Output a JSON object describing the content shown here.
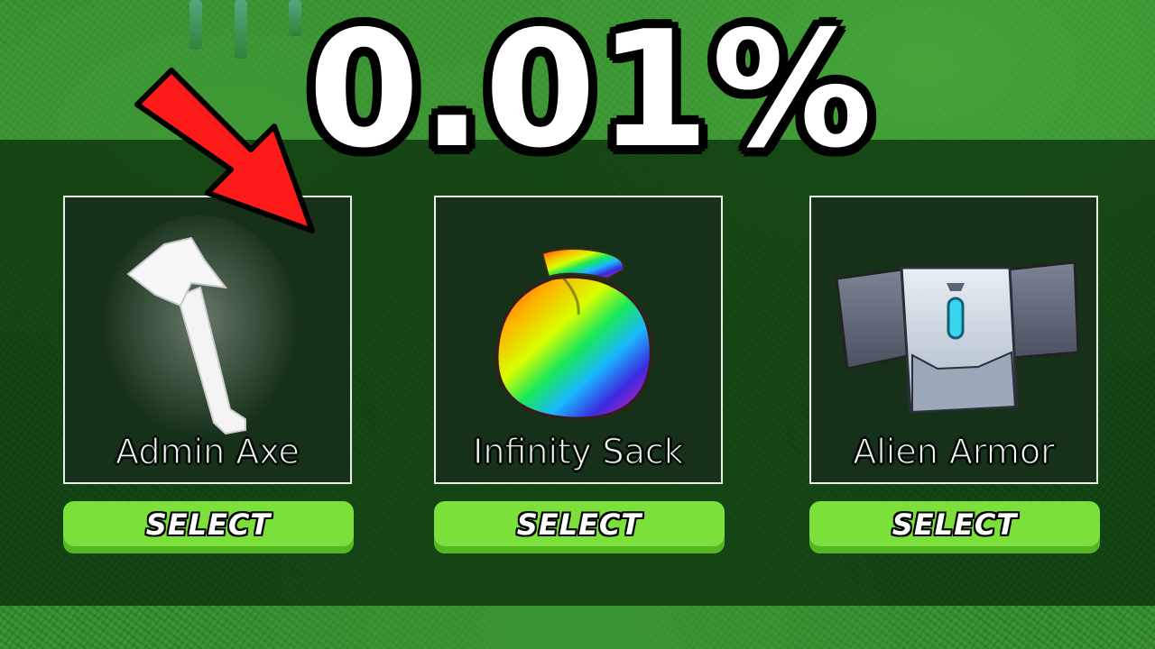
{
  "headline": "0.01%",
  "items": [
    {
      "name": "Admin Axe",
      "select_label": "SELECT",
      "icon": "axe-icon"
    },
    {
      "name": "Infinity Sack",
      "select_label": "SELECT",
      "icon": "rainbow-sack-icon"
    },
    {
      "name": "Alien Armor",
      "select_label": "SELECT",
      "icon": "armor-icon"
    }
  ],
  "colors": {
    "button": "#7be03a",
    "arrow": "#ff1a1a",
    "card_bg": "#17301a"
  }
}
